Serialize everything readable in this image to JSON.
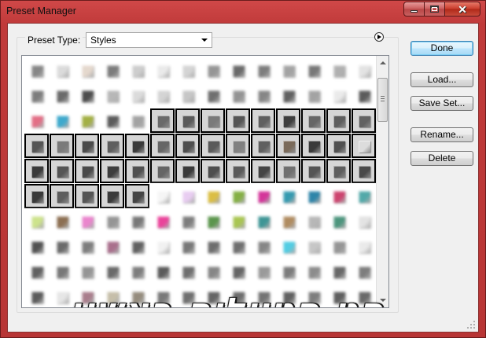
{
  "window": {
    "title": "Preset Manager"
  },
  "preset_type": {
    "label": "Preset Type:",
    "value": "Styles"
  },
  "buttons": {
    "done": "Done",
    "load": "Load...",
    "save_set": "Save Set...",
    "rename": "Rename...",
    "delete": "Delete"
  },
  "overlay_text": "סט סטיילים ראשון",
  "grid": {
    "rows": [
      [
        {
          "color": "#7a7a7a",
          "blur": true,
          "sel": false
        },
        {
          "color": "#d8d8d8",
          "blur": true,
          "sel": false
        },
        {
          "color": "#e2d4c8",
          "blur": true,
          "sel": false
        },
        {
          "color": "#6e6e6e",
          "blur": true,
          "sel": false
        },
        {
          "color": "#c8c8c8",
          "blur": true,
          "sel": false
        },
        {
          "color": "#e8e8e8",
          "blur": true,
          "sel": false
        },
        {
          "color": "#d0d0d0",
          "blur": true,
          "sel": false
        },
        {
          "color": "#8a8a8a",
          "blur": true,
          "sel": false
        },
        {
          "color": "#5a5a5a",
          "blur": true,
          "sel": false
        },
        {
          "color": "#707070",
          "blur": true,
          "sel": false
        },
        {
          "color": "#9a9a9a",
          "blur": true,
          "sel": false
        },
        {
          "color": "#6a6a6a",
          "blur": true,
          "sel": false
        },
        {
          "color": "#a8a8a8",
          "blur": true,
          "sel": false
        },
        {
          "color": "#e0e0e0",
          "blur": true,
          "sel": false
        }
      ],
      [
        {
          "color": "#707070",
          "blur": true,
          "sel": false
        },
        {
          "color": "#5a5a5a",
          "blur": true,
          "sel": false
        },
        {
          "color": "#3a3a3a",
          "blur": true,
          "sel": false
        },
        {
          "color": "#b0b0b0",
          "blur": true,
          "sel": false
        },
        {
          "color": "#d8d8d8",
          "blur": true,
          "sel": false
        },
        {
          "color": "#d0d0d0",
          "blur": true,
          "sel": false
        },
        {
          "color": "#c0c0c0",
          "blur": true,
          "sel": false
        },
        {
          "color": "#606060",
          "blur": true,
          "sel": false
        },
        {
          "color": "#888888",
          "blur": true,
          "sel": false
        },
        {
          "color": "#7a7a7a",
          "blur": true,
          "sel": false
        },
        {
          "color": "#505050",
          "blur": true,
          "sel": false
        },
        {
          "color": "#9a9a9a",
          "blur": true,
          "sel": false
        },
        {
          "color": "#e8e8e8",
          "blur": true,
          "sel": false
        },
        {
          "color": "#4a4a4a",
          "blur": true,
          "sel": false
        }
      ],
      [
        {
          "color": "#e0607a",
          "blur": true,
          "sel": false
        },
        {
          "color": "#2aa0c8",
          "blur": true,
          "sel": false
        },
        {
          "color": "#9aa830",
          "blur": true,
          "sel": false
        },
        {
          "color": "#4a4a4a",
          "blur": true,
          "sel": false
        },
        {
          "color": "#9a9a9a",
          "blur": true,
          "sel": false
        },
        {
          "color": "#6a6a6a",
          "blur": false,
          "sel": true
        },
        {
          "color": "#5a5a5a",
          "blur": false,
          "sel": true
        },
        {
          "color": "#7a7a7a",
          "blur": false,
          "sel": true
        },
        {
          "color": "#555555",
          "blur": false,
          "sel": true
        },
        {
          "color": "#606060",
          "blur": false,
          "sel": true
        },
        {
          "color": "#3e3e3e",
          "blur": false,
          "sel": true
        },
        {
          "color": "#666666",
          "blur": false,
          "sel": true
        },
        {
          "color": "#5e5e5e",
          "blur": false,
          "sel": true
        },
        {
          "color": "#626262",
          "blur": false,
          "sel": true
        }
      ],
      [
        {
          "color": "#555555",
          "blur": false,
          "sel": true
        },
        {
          "color": "#7a7a7a",
          "blur": false,
          "sel": true
        },
        {
          "color": "#4a4a4a",
          "blur": false,
          "sel": true
        },
        {
          "color": "#5e5e5e",
          "blur": false,
          "sel": true
        },
        {
          "color": "#3a3a3a",
          "blur": false,
          "sel": true
        },
        {
          "color": "#666666",
          "blur": false,
          "sel": true
        },
        {
          "color": "#4e4e4e",
          "blur": false,
          "sel": true
        },
        {
          "color": "#5a5a5a",
          "blur": false,
          "sel": true
        },
        {
          "color": "#808080",
          "blur": false,
          "sel": true
        },
        {
          "color": "#606060",
          "blur": false,
          "sel": true
        },
        {
          "color": "#7a6a5a",
          "blur": false,
          "sel": true
        },
        {
          "color": "#3a3a3a",
          "blur": false,
          "sel": true
        },
        {
          "color": "#505050",
          "blur": false,
          "sel": true
        },
        {
          "color": "#dcdcdc",
          "blur": false,
          "sel": true
        }
      ],
      [
        {
          "color": "#3a3a3a",
          "blur": false,
          "sel": true
        },
        {
          "color": "#555555",
          "blur": false,
          "sel": true
        },
        {
          "color": "#4a4a4a",
          "blur": false,
          "sel": true
        },
        {
          "color": "#3e3e3e",
          "blur": false,
          "sel": true
        },
        {
          "color": "#505050",
          "blur": false,
          "sel": true
        },
        {
          "color": "#666666",
          "blur": false,
          "sel": true
        },
        {
          "color": "#3a3a3a",
          "blur": false,
          "sel": true
        },
        {
          "color": "#4e4e4e",
          "blur": false,
          "sel": true
        },
        {
          "color": "#5a5a5a",
          "blur": false,
          "sel": true
        },
        {
          "color": "#444444",
          "blur": false,
          "sel": true
        },
        {
          "color": "#707070",
          "blur": false,
          "sel": true
        },
        {
          "color": "#555555",
          "blur": false,
          "sel": true
        },
        {
          "color": "#5e5e5e",
          "blur": false,
          "sel": true
        },
        {
          "color": "#4a4a4a",
          "blur": false,
          "sel": true
        }
      ],
      [
        {
          "color": "#3a3a3a",
          "blur": false,
          "sel": true
        },
        {
          "color": "#5e5e5e",
          "blur": false,
          "sel": true
        },
        {
          "color": "#555555",
          "blur": false,
          "sel": true
        },
        {
          "color": "#3a3a3a",
          "blur": false,
          "sel": true
        },
        {
          "color": "#444444",
          "blur": false,
          "sel": true
        },
        {
          "color": "#f4f4f4",
          "blur": true,
          "sel": false
        },
        {
          "color": "#e6c8f0",
          "blur": true,
          "sel": false
        },
        {
          "color": "#d8b830",
          "blur": true,
          "sel": false
        },
        {
          "color": "#78a830",
          "blur": true,
          "sel": false
        },
        {
          "color": "#d02090",
          "blur": true,
          "sel": false
        },
        {
          "color": "#2090a8",
          "blur": true,
          "sel": false
        },
        {
          "color": "#1878a0",
          "blur": true,
          "sel": false
        },
        {
          "color": "#c83060",
          "blur": true,
          "sel": false
        },
        {
          "color": "#40a0a0",
          "blur": true,
          "sel": false
        }
      ],
      [
        {
          "color": "#c8e080",
          "blur": true,
          "sel": false
        },
        {
          "color": "#806040",
          "blur": true,
          "sel": false
        },
        {
          "color": "#e878c8",
          "blur": true,
          "sel": false
        },
        {
          "color": "#8a8a8a",
          "blur": true,
          "sel": false
        },
        {
          "color": "#6a6a6a",
          "blur": true,
          "sel": false
        },
        {
          "color": "#e83090",
          "blur": true,
          "sel": false
        },
        {
          "color": "#707070",
          "blur": true,
          "sel": false
        },
        {
          "color": "#4a8a3a",
          "blur": true,
          "sel": false
        },
        {
          "color": "#a0c040",
          "blur": true,
          "sel": false
        },
        {
          "color": "#2a8a8a",
          "blur": true,
          "sel": false
        },
        {
          "color": "#a88050",
          "blur": true,
          "sel": false
        },
        {
          "color": "#b0b0b0",
          "blur": true,
          "sel": false
        },
        {
          "color": "#3a8a70",
          "blur": true,
          "sel": false
        },
        {
          "color": "#e0e0e0",
          "blur": true,
          "sel": false
        }
      ],
      [
        {
          "color": "#404040",
          "blur": true,
          "sel": false
        },
        {
          "color": "#5a5a5a",
          "blur": true,
          "sel": false
        },
        {
          "color": "#707070",
          "blur": true,
          "sel": false
        },
        {
          "color": "#a06080",
          "blur": true,
          "sel": false
        },
        {
          "color": "#505050",
          "blur": true,
          "sel": false
        },
        {
          "color": "#f0f0f0",
          "blur": true,
          "sel": false
        },
        {
          "color": "#6a6a6a",
          "blur": true,
          "sel": false
        },
        {
          "color": "#5e5e5e",
          "blur": true,
          "sel": false
        },
        {
          "color": "#606060",
          "blur": true,
          "sel": false
        },
        {
          "color": "#7a7a7a",
          "blur": true,
          "sel": false
        },
        {
          "color": "#40c8e0",
          "blur": true,
          "sel": false
        },
        {
          "color": "#c0c0c0",
          "blur": true,
          "sel": false
        },
        {
          "color": "#8a8a8a",
          "blur": true,
          "sel": false
        },
        {
          "color": "#e8e8e8",
          "blur": true,
          "sel": false
        }
      ],
      [
        {
          "color": "#505050",
          "blur": true,
          "sel": false
        },
        {
          "color": "#6a6a6a",
          "blur": true,
          "sel": false
        },
        {
          "color": "#8a8a8a",
          "blur": true,
          "sel": false
        },
        {
          "color": "#5a5a5a",
          "blur": true,
          "sel": false
        },
        {
          "color": "#707070",
          "blur": true,
          "sel": false
        },
        {
          "color": "#4a4a4a",
          "blur": true,
          "sel": false
        },
        {
          "color": "#606060",
          "blur": true,
          "sel": false
        },
        {
          "color": "#7a7a7a",
          "blur": true,
          "sel": false
        },
        {
          "color": "#555555",
          "blur": true,
          "sel": false
        },
        {
          "color": "#909090",
          "blur": true,
          "sel": false
        },
        {
          "color": "#6e6e6e",
          "blur": true,
          "sel": false
        },
        {
          "color": "#808080",
          "blur": true,
          "sel": false
        },
        {
          "color": "#585858",
          "blur": true,
          "sel": false
        },
        {
          "color": "#707070",
          "blur": true,
          "sel": false
        }
      ],
      [
        {
          "color": "#4a4a4a",
          "blur": true,
          "sel": false
        },
        {
          "color": "#e4e4e4",
          "blur": true,
          "sel": false
        },
        {
          "color": "#a07080",
          "blur": true,
          "sel": false
        },
        {
          "color": "#c0b8a0",
          "blur": true,
          "sel": false
        },
        {
          "color": "#8a8070",
          "blur": true,
          "sel": false
        },
        {
          "color": "#6a6a6a",
          "blur": true,
          "sel": false
        },
        {
          "color": "#606060",
          "blur": true,
          "sel": false
        },
        {
          "color": "#555555",
          "blur": true,
          "sel": false
        },
        {
          "color": "#5e5e5e",
          "blur": true,
          "sel": false
        },
        {
          "color": "#666666",
          "blur": true,
          "sel": false
        },
        {
          "color": "#505050",
          "blur": true,
          "sel": false
        },
        {
          "color": "#707070",
          "blur": true,
          "sel": false
        },
        {
          "color": "#4e4e4e",
          "blur": true,
          "sel": false
        },
        {
          "color": "#5a5a5a",
          "blur": true,
          "sel": false
        }
      ]
    ]
  }
}
